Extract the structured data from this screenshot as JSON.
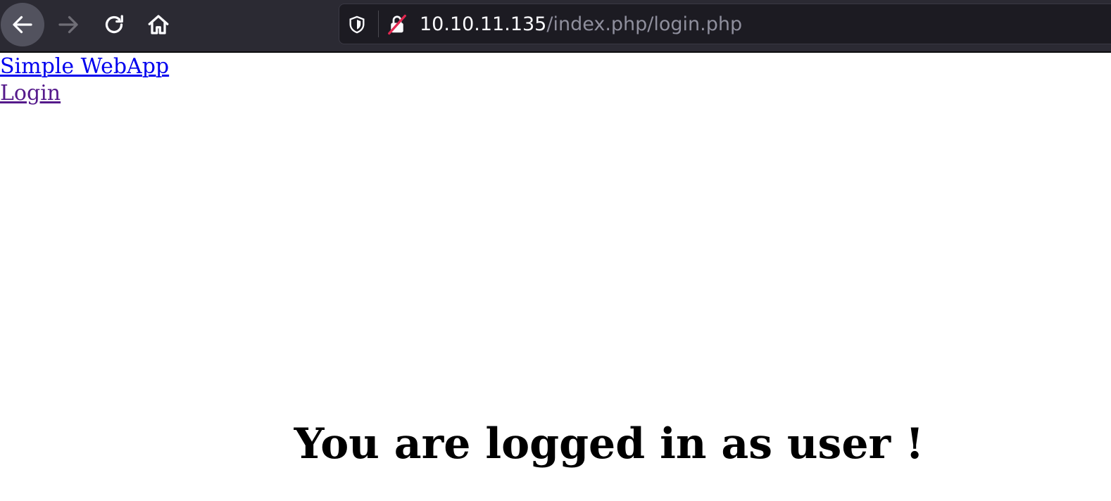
{
  "browser": {
    "toolbar": {
      "back_icon": "back-arrow-icon",
      "forward_icon": "forward-arrow-icon",
      "reload_icon": "reload-icon",
      "home_icon": "home-icon"
    },
    "urlbar": {
      "tracking_icon": "shield-icon",
      "security_icon": "insecure-lock-icon",
      "host": "10.10.11.135",
      "path": "/index.php/login.php"
    },
    "colors": {
      "toolbar_bg": "#2b2a33",
      "urlbar_bg": "#1c1b22",
      "insecure_strike": "#e22850"
    }
  },
  "page": {
    "nav": {
      "home_link": "Simple WebApp",
      "login_link": "Login"
    },
    "message": "You are logged in as user !",
    "colors": {
      "link": "#0000ee",
      "visited_link": "#551a8b"
    }
  }
}
